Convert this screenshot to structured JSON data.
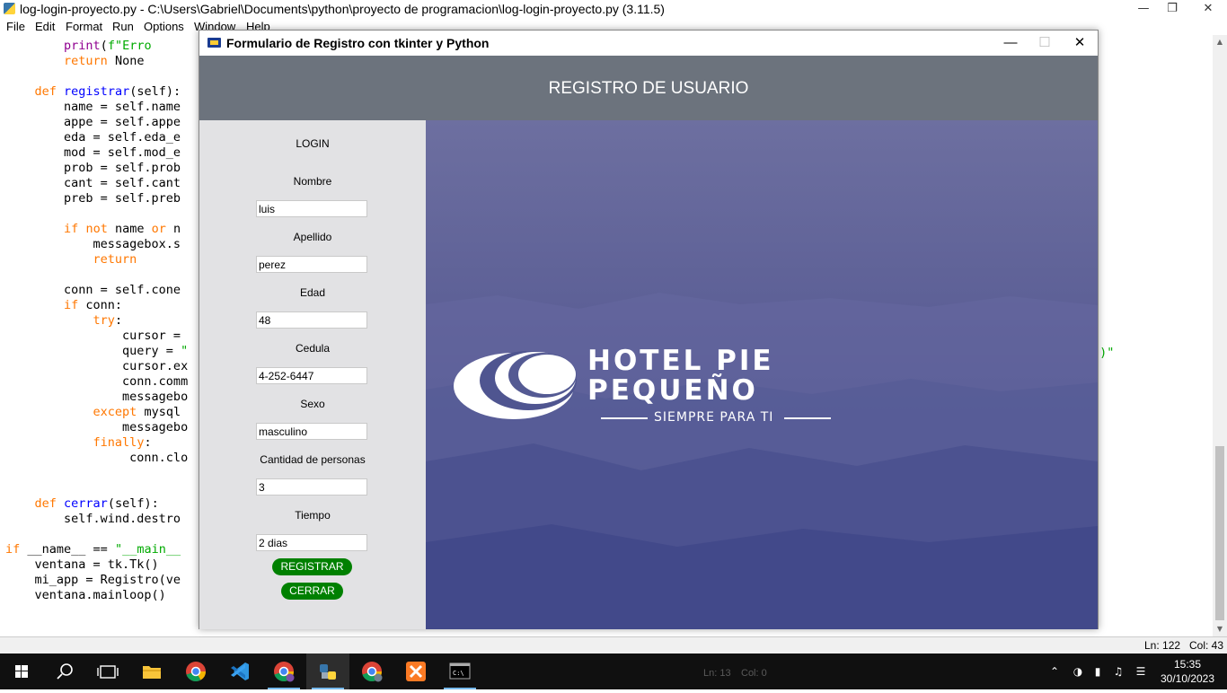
{
  "idle_window": {
    "title": "log-login-proyecto.py - C:\\Users\\Gabriel\\Documents\\python\\proyecto de programacion\\log-login-proyecto.py (3.11.5)",
    "menu": [
      "File",
      "Edit",
      "Format",
      "Run",
      "Options",
      "Window",
      "Help"
    ],
    "code_lines": [
      "        print(f\"Erro",
      "        return None",
      "",
      "    def registrar(self):",
      "        name = self.name",
      "        appe = self.appe",
      "        eda = self.eda_e",
      "        mod = self.mod_e",
      "        prob = self.prob",
      "        cant = self.cant",
      "        preb = self.preb",
      "",
      "        if not name or n",
      "            messagebox.s",
      "            return",
      "",
      "        conn = self.cone",
      "        if conn:",
      "            try:",
      "                cursor =",
      "                query = \"",
      "                cursor.ex",
      "                conn.comm",
      "                messagebo",
      "            except mysql",
      "                messagebo",
      "            finally:",
      "                 conn.clo",
      "",
      "",
      "    def cerrar(self):",
      "        self.wind.destro",
      "",
      "if __name__ == \"__main__",
      "    ventana = tk.Tk()",
      "    mi_app = Registro(ve",
      "    ventana.mainloop()"
    ],
    "code_overflow_fragment": "s)\"",
    "status_ln": "Ln: 122",
    "status_col": "Col: 43"
  },
  "tk_window": {
    "title": "Formulario de Registro con tkinter y Python",
    "header_title": "REGISTRO DE USUARIO",
    "form_title": "LOGIN",
    "fields": [
      {
        "label": "Nombre",
        "value": "luis"
      },
      {
        "label": "Apellido",
        "value": "perez"
      },
      {
        "label": "Edad",
        "value": "48"
      },
      {
        "label": "Cedula",
        "value": "4-252-6447"
      },
      {
        "label": "Sexo",
        "value": "masculino"
      },
      {
        "label": "Cantidad de personas",
        "value": "3"
      },
      {
        "label": "Tiempo",
        "value": "2 dias"
      }
    ],
    "register_label": "REGISTRAR",
    "close_label": "CERRAR",
    "logo_line1": "HOTEL PIE",
    "logo_line2": "PEQUEÑO",
    "logo_tagline": "SIEMPRE PARA TI"
  },
  "taskbar": {
    "apps": [
      "start-icon",
      "search-icon",
      "task-view-icon",
      "file-explorer-icon",
      "chrome-icon",
      "vscode-icon",
      "chrome-profile-icon",
      "python-idle-icon",
      "chrome-profile-2-icon",
      "xampp-icon",
      "terminal-icon"
    ],
    "time": "15:35",
    "date": "30/10/2023",
    "ghost_ln": "Ln: 13",
    "ghost_col": "Col: 0"
  },
  "colors": {
    "header_bg": "#6c737d",
    "form_bg": "#e2e2e4",
    "button_green": "#008000",
    "image_blue": "#4f5590"
  }
}
